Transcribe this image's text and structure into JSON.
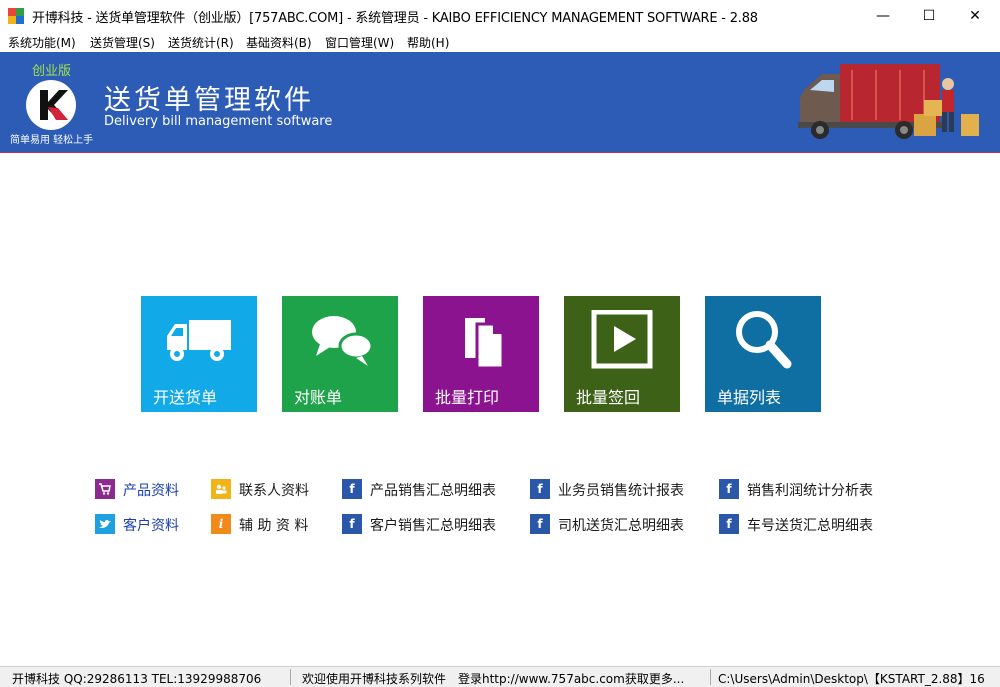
{
  "window": {
    "title": "开博科技 - 送货单管理软件（创业版）[757ABC.COM] - 系统管理员 - KAIBO EFFICIENCY MANAGEMENT SOFTWARE - 2.88",
    "minimize": "—",
    "maximize": "☐",
    "close": "✕"
  },
  "menu": {
    "items": [
      "系统功能(M)",
      "送货管理(S)",
      "送货统计(R)",
      "基础资料(B)",
      "窗口管理(W)",
      "帮助(H)"
    ]
  },
  "banner": {
    "edition": "创业版",
    "logo_letter": "K",
    "slogan": "简单易用 轻松上手",
    "title": "送货单管理软件",
    "subtitle": "Delivery bill management software",
    "color": "#2d5cb6"
  },
  "tiles": [
    {
      "label": "开送货单",
      "icon": "truck-icon",
      "color": "#11a9e8"
    },
    {
      "label": "对账单",
      "icon": "chat-bubbles-icon",
      "color": "#1ea34a"
    },
    {
      "label": "批量打印",
      "icon": "documents-icon",
      "color": "#8b138f"
    },
    {
      "label": "批量签回",
      "icon": "play-icon",
      "color": "#3d6117"
    },
    {
      "label": "单据列表",
      "icon": "search-icon",
      "color": "#0f6fa3"
    }
  ],
  "links": {
    "row1": [
      {
        "label": "产品资料",
        "icon": "cart-icon",
        "color": "#8b2a8f",
        "active": true
      },
      {
        "label": "联系人资料",
        "icon": "contacts-icon",
        "color": "#f2b318"
      },
      {
        "label": "产品销售汇总明细表",
        "icon": "facebook-icon",
        "color": "#2b57a8"
      },
      {
        "label": "业务员销售统计报表",
        "icon": "facebook-icon",
        "color": "#2b57a8"
      },
      {
        "label": "销售利润统计分析表",
        "icon": "facebook-icon",
        "color": "#2b57a8"
      }
    ],
    "row2": [
      {
        "label": "客户资料",
        "icon": "twitter-icon",
        "color": "#1fa0e0",
        "active": true
      },
      {
        "label": "辅 助 资 料",
        "icon": "info-icon",
        "color": "#f08a1b"
      },
      {
        "label": "客户销售汇总明细表",
        "icon": "facebook-icon",
        "color": "#2b57a8"
      },
      {
        "label": "司机送货汇总明细表",
        "icon": "facebook-icon",
        "color": "#2b57a8"
      },
      {
        "label": "车号送货汇总明细表",
        "icon": "facebook-icon",
        "color": "#2b57a8"
      }
    ]
  },
  "status": {
    "company": "开博科技 QQ:29286113 TEL:13929988706",
    "welcome": "欢迎使用开博科技系列软件",
    "login": "登录http://www.757abc.com获取更多...",
    "path": "C:\\Users\\Admin\\Desktop\\【KSTART_2.88】16"
  }
}
